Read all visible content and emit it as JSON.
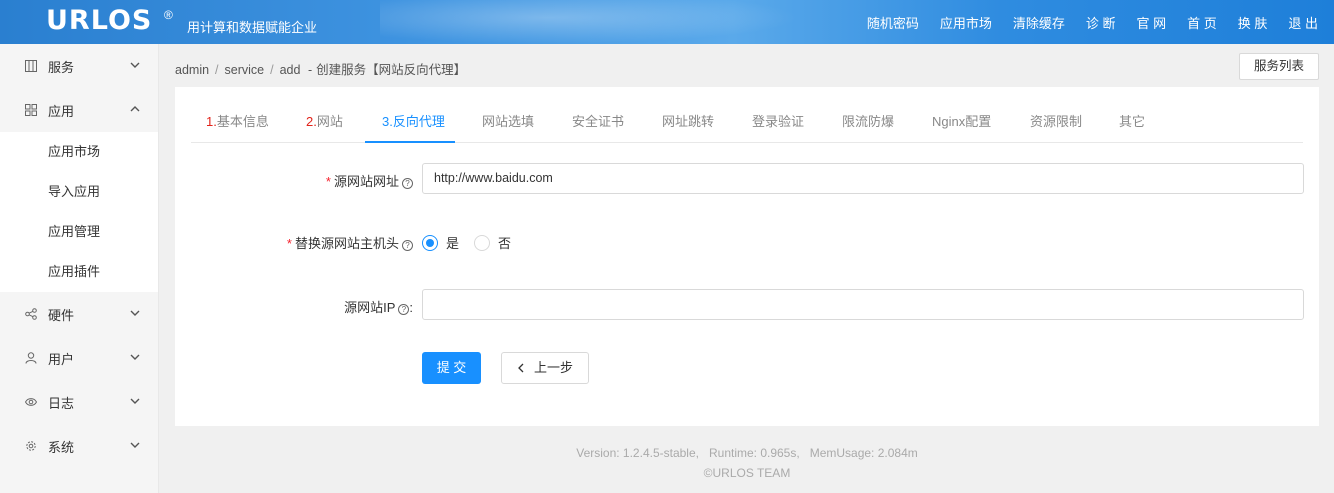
{
  "header": {
    "logo": "URLOS",
    "logo_mark": "®",
    "tagline": "用计算和数据赋能企业",
    "nav": [
      "随机密码",
      "应用市场",
      "清除缓存",
      "诊 断",
      "官 网",
      "首 页",
      "换 肤",
      "退 出"
    ]
  },
  "sidebar": {
    "items": [
      {
        "label": "服务",
        "icon": "grid-bars-icon",
        "expanded": false
      },
      {
        "label": "应用",
        "icon": "apps-icon",
        "expanded": true,
        "children": [
          "应用市场",
          "导入应用",
          "应用管理",
          "应用插件"
        ]
      },
      {
        "label": "硬件",
        "icon": "share-nodes-icon",
        "expanded": false
      },
      {
        "label": "用户",
        "icon": "user-icon",
        "expanded": false
      },
      {
        "label": "日志",
        "icon": "eye-icon",
        "expanded": false
      },
      {
        "label": "系统",
        "icon": "gear-icon",
        "expanded": false
      }
    ]
  },
  "breadcrumb": {
    "parts": [
      "admin",
      "service",
      "add"
    ],
    "dash": "-",
    "page": "创建服务【网站反向代理】"
  },
  "list_button": "服务列表",
  "tabs": [
    {
      "num": "1.",
      "label": "基本信息",
      "state": "done"
    },
    {
      "num": "2.",
      "label": "网站",
      "state": "done"
    },
    {
      "num": "3.",
      "label": "反向代理",
      "state": "active"
    },
    {
      "num": "",
      "label": "网站选填",
      "state": "pending"
    },
    {
      "num": "",
      "label": "安全证书",
      "state": "pending"
    },
    {
      "num": "",
      "label": "网址跳转",
      "state": "pending"
    },
    {
      "num": "",
      "label": "登录验证",
      "state": "pending"
    },
    {
      "num": "",
      "label": "限流防爆",
      "state": "pending"
    },
    {
      "num": "",
      "label": "Nginx配置",
      "state": "pending"
    },
    {
      "num": "",
      "label": "资源限制",
      "state": "pending"
    },
    {
      "num": "",
      "label": "其它",
      "state": "pending"
    }
  ],
  "form": {
    "source_url": {
      "label": "源网站网址",
      "required": true,
      "value": "http://www.baidu.com"
    },
    "replace_host": {
      "label": "替换源网站主机头",
      "required": true,
      "options": [
        "是",
        "否"
      ],
      "selected": "是"
    },
    "source_ip": {
      "label": "源网站IP",
      "required": false,
      "value": "",
      "colon": ":"
    },
    "submit": "提 交",
    "back": "上一步"
  },
  "footer": {
    "line1": "Version: 1.2.4.5-stable,   Runtime: 0.965s,   MemUsage: 2.084m",
    "line2": "©URLOS TEAM"
  }
}
